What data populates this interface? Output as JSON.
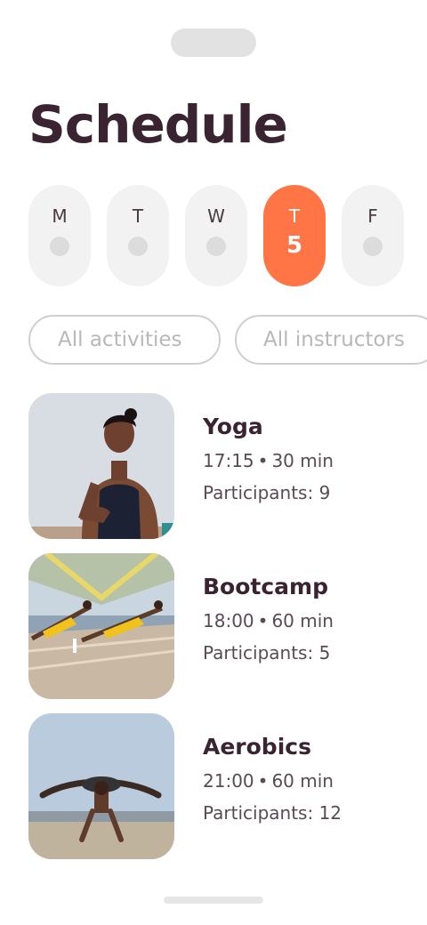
{
  "page": {
    "title": "Schedule"
  },
  "days": [
    {
      "letter": "M",
      "date": "",
      "active": false
    },
    {
      "letter": "T",
      "date": "",
      "active": false
    },
    {
      "letter": "W",
      "date": "",
      "active": false
    },
    {
      "letter": "T",
      "date": "5",
      "active": true
    },
    {
      "letter": "F",
      "date": "",
      "active": false
    }
  ],
  "filters": {
    "activities": "All activities",
    "instructors": "All instructors"
  },
  "classes": [
    {
      "name": "Yoga",
      "time": "17:15",
      "duration": "30 min",
      "participants": "Participants: 9",
      "photo": "yoga-photo"
    },
    {
      "name": "Bootcamp",
      "time": "18:00",
      "duration": "60 min",
      "participants": "Participants: 5",
      "photo": "bootcamp-photo"
    },
    {
      "name": "Aerobics",
      "time": "21:00",
      "duration": "60 min",
      "participants": "Participants: 12",
      "photo": "aerobics-photo"
    }
  ],
  "meta_separator": "•",
  "colors": {
    "accent": "#ff7545",
    "text": "#3a2431",
    "pill_bg": "#f2f2f2"
  }
}
